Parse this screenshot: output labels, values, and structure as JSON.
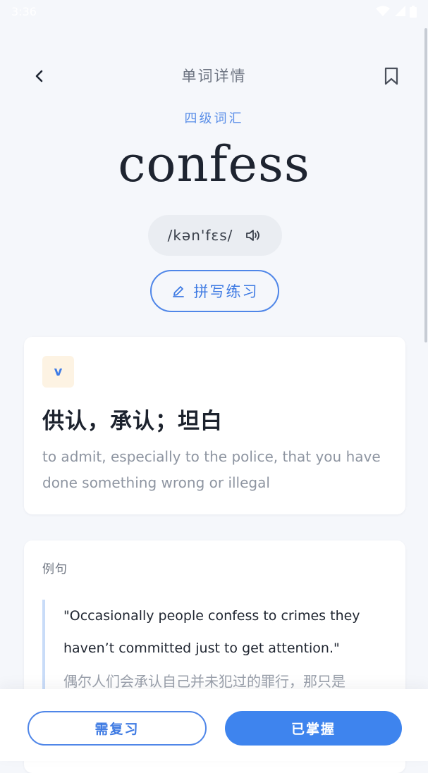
{
  "status_bar": {
    "time": "3:36"
  },
  "header": {
    "title": "单词详情",
    "back_icon": "chevron-left-icon",
    "bookmark_icon": "bookmark-icon"
  },
  "word": {
    "level": "四级词汇",
    "text": "confess",
    "phonetic": "/kən'fɛs/",
    "spell_practice_label": "拼写练习"
  },
  "definition": {
    "pos": "v",
    "meaning_cn": "供认，承认；坦白",
    "meaning_en": "to admit, especially to the police, that you have done something wrong or illegal"
  },
  "example": {
    "label": "例句",
    "sentence_en": "\"Occasionally people confess to crimes they haven’t committed just to get attention.\"",
    "sentence_cn": "偶尔人们会承认自己并未犯过的罪行，那只是"
  },
  "actions": {
    "review_label": "需复习",
    "mastered_label": "已掌握"
  },
  "colors": {
    "accent": "#3e84ee",
    "background": "#f5f7fb",
    "level_tag": "#5b8fe8"
  }
}
